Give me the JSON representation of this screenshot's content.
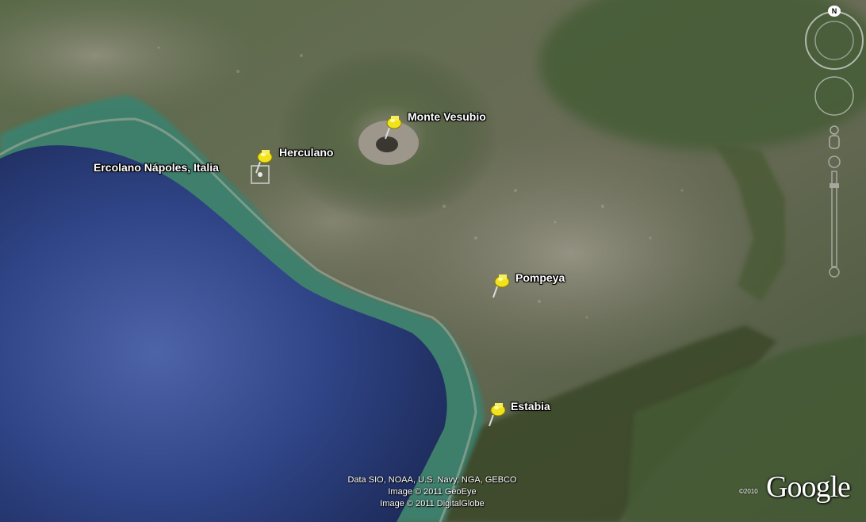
{
  "map": {
    "labels": {
      "vesubio": "Monte Vesubio",
      "herculano": "Herculano",
      "ercolano": "Ercolano Nápoles, Italia",
      "pompeya": "Pompeya",
      "estabia": "Estabia"
    },
    "pins": [
      "herculano",
      "vesubio",
      "pompeya",
      "estabia"
    ],
    "pin_color": "#f2e21a"
  },
  "credits": {
    "line1": "Data SIO, NOAA, U.S. Navy, NGA, GEBCO",
    "line2": "Image © 2011 GeoEye",
    "line3": "Image © 2011 DigitalGlobe"
  },
  "branding": {
    "copyright": "©2010",
    "logo": "Google"
  },
  "navigation": {
    "compass_letter": "N",
    "controls": [
      "compass-ring",
      "look-joystick",
      "street-view-pegman",
      "zoom-slider"
    ]
  }
}
